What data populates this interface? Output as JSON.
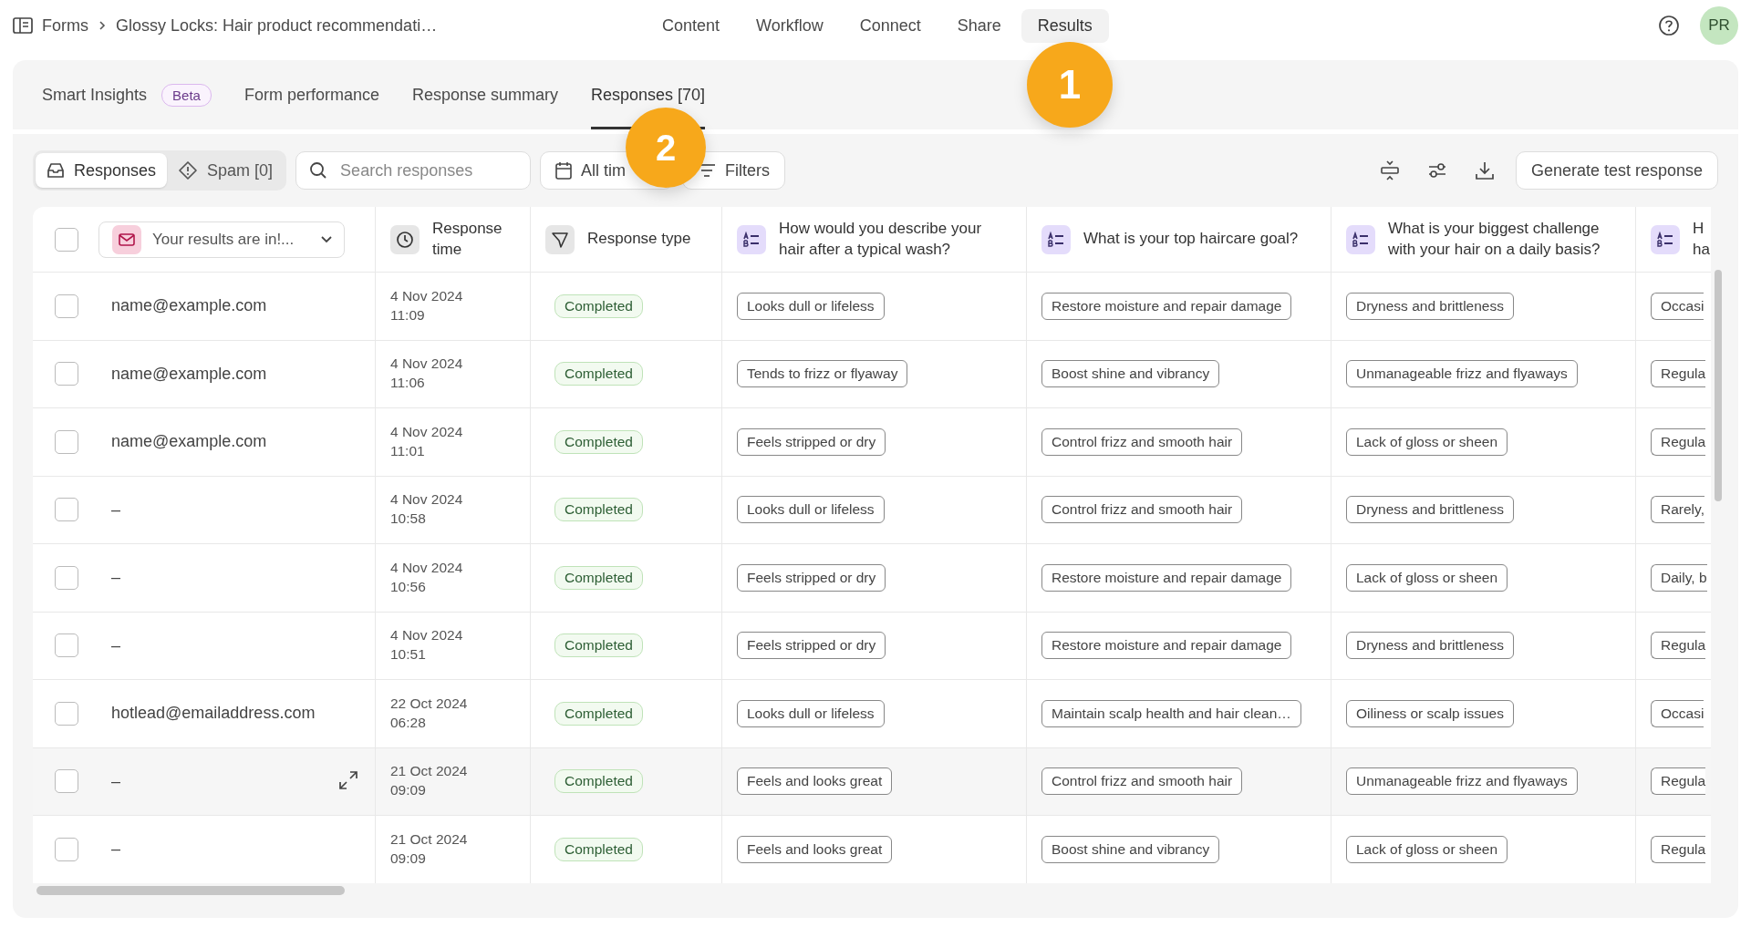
{
  "breadcrumb": {
    "root": "Forms",
    "title": "Glossy Locks: Hair product recommendati…"
  },
  "nav": [
    {
      "label": "Content",
      "selected": false
    },
    {
      "label": "Workflow",
      "selected": false
    },
    {
      "label": "Connect",
      "selected": false
    },
    {
      "label": "Share",
      "selected": false
    },
    {
      "label": "Results",
      "selected": true
    }
  ],
  "avatar": "PR",
  "tabs": [
    {
      "label": "Smart Insights",
      "badge": "Beta",
      "selected": false
    },
    {
      "label": "Form performance",
      "selected": false
    },
    {
      "label": "Response summary",
      "selected": false
    },
    {
      "label": "Responses [70]",
      "selected": true
    }
  ],
  "toolbar": {
    "segments": [
      {
        "label": "Responses",
        "kind": "inbox",
        "selected": true
      },
      {
        "label": "Spam [0]",
        "kind": "spam",
        "selected": false
      }
    ],
    "search": {
      "placeholder": "Search responses"
    },
    "date_filter": "All tim",
    "filters": "Filters",
    "generate_button": "Generate test response"
  },
  "table": {
    "email_column": "Your results are in!...",
    "columns": [
      {
        "label": "Response time",
        "kind": "time"
      },
      {
        "label": "Response type",
        "kind": "type"
      },
      {
        "label": "How would you describe your hair after a typical wash?",
        "kind": "choice"
      },
      {
        "label": "What is your top haircare goal?",
        "kind": "choice"
      },
      {
        "label": "What is your biggest challenge with your hair on a daily basis?",
        "kind": "choice"
      },
      {
        "label": "H ha",
        "kind": "choice"
      }
    ],
    "all_checked": false,
    "rows": [
      {
        "checked": false,
        "highlighted": false,
        "email": "name@example.com",
        "date": "4 Nov 2024",
        "time": "11:09",
        "status": "Completed",
        "answers": [
          "Looks dull or lifeless",
          "Restore moisture and repair damage",
          "Dryness and brittleness",
          "Occasi"
        ]
      },
      {
        "checked": false,
        "highlighted": false,
        "email": "name@example.com",
        "date": "4 Nov 2024",
        "time": "11:06",
        "status": "Completed",
        "answers": [
          "Tends to frizz or flyaway",
          "Boost shine and vibrancy",
          "Unmanageable frizz and flyaways",
          "Regula"
        ]
      },
      {
        "checked": false,
        "highlighted": false,
        "email": "name@example.com",
        "date": "4 Nov 2024",
        "time": "11:01",
        "status": "Completed",
        "answers": [
          "Feels stripped or dry",
          "Control frizz and smooth hair",
          "Lack of gloss or sheen",
          "Regula"
        ]
      },
      {
        "checked": false,
        "highlighted": false,
        "email": "–",
        "date": "4 Nov 2024",
        "time": "10:58",
        "status": "Completed",
        "answers": [
          "Looks dull or lifeless",
          "Control frizz and smooth hair",
          "Dryness and brittleness",
          "Rarely,"
        ]
      },
      {
        "checked": false,
        "highlighted": false,
        "email": "–",
        "date": "4 Nov 2024",
        "time": "10:56",
        "status": "Completed",
        "answers": [
          "Feels stripped or dry",
          "Restore moisture and repair damage",
          "Lack of gloss or sheen",
          "Daily, b"
        ]
      },
      {
        "checked": false,
        "highlighted": false,
        "email": "–",
        "date": "4 Nov 2024",
        "time": "10:51",
        "status": "Completed",
        "answers": [
          "Feels stripped or dry",
          "Restore moisture and repair damage",
          "Dryness and brittleness",
          "Regula"
        ]
      },
      {
        "checked": false,
        "highlighted": false,
        "email": "hotlead@emailaddress.com",
        "date": "22 Oct 2024",
        "time": "06:28",
        "status": "Completed",
        "answers": [
          "Looks dull or lifeless",
          "Maintain scalp health and hair clean…",
          "Oiliness or scalp issues",
          "Occasi"
        ]
      },
      {
        "checked": false,
        "highlighted": true,
        "email": "–",
        "date": "21 Oct 2024",
        "time": "09:09",
        "status": "Completed",
        "answers": [
          "Feels and looks great",
          "Control frizz and smooth hair",
          "Unmanageable frizz and flyaways",
          "Regula"
        ]
      },
      {
        "checked": false,
        "highlighted": false,
        "email": "–",
        "date": "21 Oct 2024",
        "time": "09:09",
        "status": "Completed",
        "answers": [
          "Feels and looks great",
          "Boost shine and vibrancy",
          "Lack of gloss or sheen",
          "Regula"
        ]
      }
    ]
  },
  "annotations": [
    {
      "label": "1"
    },
    {
      "label": "2"
    }
  ]
}
